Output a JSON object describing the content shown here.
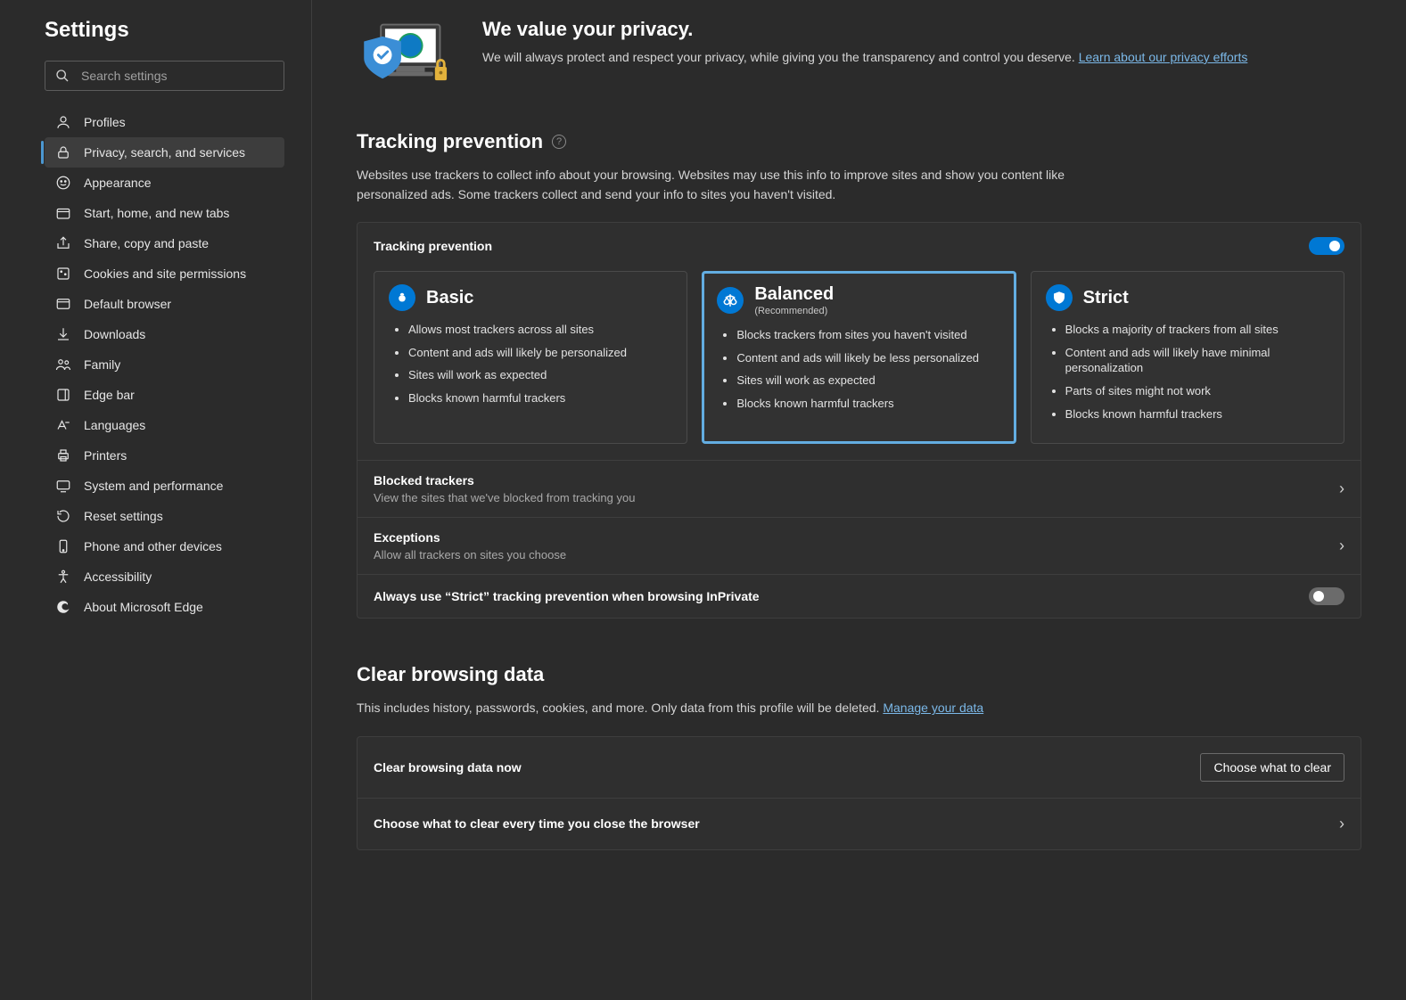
{
  "sidebar": {
    "title": "Settings",
    "search_placeholder": "Search settings",
    "items": [
      {
        "label": "Profiles"
      },
      {
        "label": "Privacy, search, and services"
      },
      {
        "label": "Appearance"
      },
      {
        "label": "Start, home, and new tabs"
      },
      {
        "label": "Share, copy and paste"
      },
      {
        "label": "Cookies and site permissions"
      },
      {
        "label": "Default browser"
      },
      {
        "label": "Downloads"
      },
      {
        "label": "Family"
      },
      {
        "label": "Edge bar"
      },
      {
        "label": "Languages"
      },
      {
        "label": "Printers"
      },
      {
        "label": "System and performance"
      },
      {
        "label": "Reset settings"
      },
      {
        "label": "Phone and other devices"
      },
      {
        "label": "Accessibility"
      },
      {
        "label": "About Microsoft Edge"
      }
    ]
  },
  "hero": {
    "title": "We value your privacy.",
    "desc_prefix": "We will always protect and respect your privacy, while giving you the transparency and control you deserve. ",
    "link": "Learn about our privacy efforts"
  },
  "tracking": {
    "title": "Tracking prevention",
    "desc": "Websites use trackers to collect info about your browsing. Websites may use this info to improve sites and show you content like personalized ads. Some trackers collect and send your info to sites you haven't visited.",
    "toggle_label": "Tracking prevention",
    "cards": [
      {
        "title": "Basic",
        "sub": "",
        "bullets": [
          "Allows most trackers across all sites",
          "Content and ads will likely be personalized",
          "Sites will work as expected",
          "Blocks known harmful trackers"
        ]
      },
      {
        "title": "Balanced",
        "sub": "(Recommended)",
        "bullets": [
          "Blocks trackers from sites you haven't visited",
          "Content and ads will likely be less personalized",
          "Sites will work as expected",
          "Blocks known harmful trackers"
        ]
      },
      {
        "title": "Strict",
        "sub": "",
        "bullets": [
          "Blocks a majority of trackers from all sites",
          "Content and ads will likely have minimal personalization",
          "Parts of sites might not work",
          "Blocks known harmful trackers"
        ]
      }
    ],
    "rows": {
      "blocked_title": "Blocked trackers",
      "blocked_sub": "View the sites that we've blocked from tracking you",
      "exceptions_title": "Exceptions",
      "exceptions_sub": "Allow all trackers on sites you choose",
      "inprivate_title": "Always use “Strict” tracking prevention when browsing InPrivate"
    }
  },
  "clear": {
    "title": "Clear browsing data",
    "desc_prefix": "This includes history, passwords, cookies, and more. Only data from this profile will be deleted. ",
    "link": "Manage your data",
    "row1_title": "Clear browsing data now",
    "row1_button": "Choose what to clear",
    "row2_title": "Choose what to clear every time you close the browser"
  }
}
